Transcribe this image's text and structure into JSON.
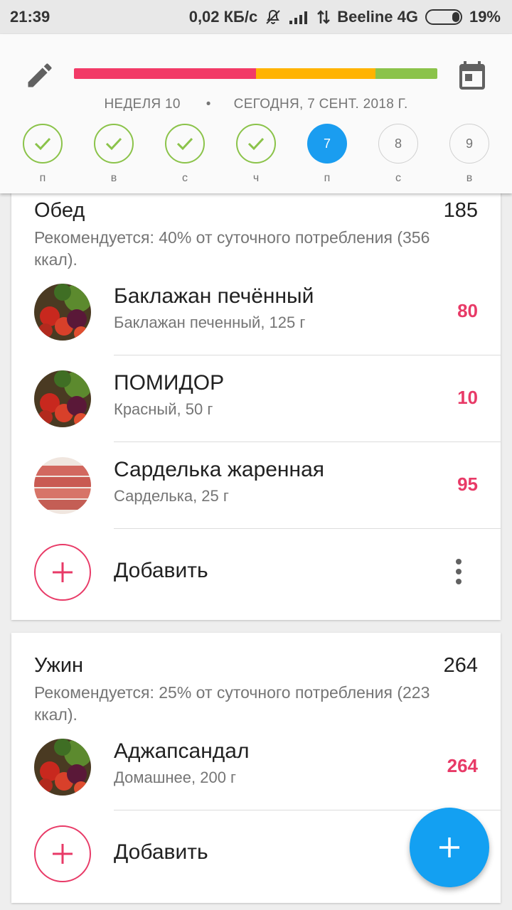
{
  "status_bar": {
    "time": "21:39",
    "speed": "0,02 КБ/с",
    "carrier": "Beeline 4G",
    "battery": "19%"
  },
  "header": {
    "week": "НЕДЕЛЯ 10",
    "separator": "•",
    "date": "СЕГОДНЯ, 7 СЕНТ. 2018 Г.",
    "progress": [
      {
        "color": "#f23a67",
        "fraction": 0.5
      },
      {
        "color": "#ffb300",
        "fraction": 0.33
      },
      {
        "color": "#8bc34a",
        "fraction": 0.17
      }
    ],
    "days": [
      {
        "label": "п",
        "value": "",
        "state": "done"
      },
      {
        "label": "в",
        "value": "",
        "state": "done"
      },
      {
        "label": "с",
        "value": "",
        "state": "done"
      },
      {
        "label": "ч",
        "value": "",
        "state": "done"
      },
      {
        "label": "п",
        "value": "7",
        "state": "today"
      },
      {
        "label": "с",
        "value": "8",
        "state": "future"
      },
      {
        "label": "в",
        "value": "9",
        "state": "future"
      }
    ]
  },
  "meals": [
    {
      "title": "Обед",
      "total": "185",
      "recommendation": "Рекомендуется: 40% от суточного потребления (356 ккал).",
      "items": [
        {
          "name": "Баклажан печённый",
          "desc": "Баклажан печенный, 125 г",
          "kcal": "80",
          "image": "vegetables"
        },
        {
          "name": "ПОМИДОР",
          "desc": "Красный, 50 г",
          "kcal": "10",
          "image": "vegetables"
        },
        {
          "name": "Сарделька жаренная",
          "desc": "Сарделька, 25 г",
          "kcal": "95",
          "image": "sausages"
        }
      ],
      "add_label": "Добавить"
    },
    {
      "title": "Ужин",
      "total": "264",
      "recommendation": "Рекомендуется: 25% от суточного потребления (223 ккал).",
      "items": [
        {
          "name": "Аджапсандал",
          "desc": "Домашнее, 200 г",
          "kcal": "264",
          "image": "vegetables"
        }
      ],
      "add_label": "Добавить"
    }
  ],
  "colors": {
    "accent": "#e83a67",
    "fab": "#13a0f2",
    "today": "#1a9df0",
    "done": "#8bc34a"
  }
}
